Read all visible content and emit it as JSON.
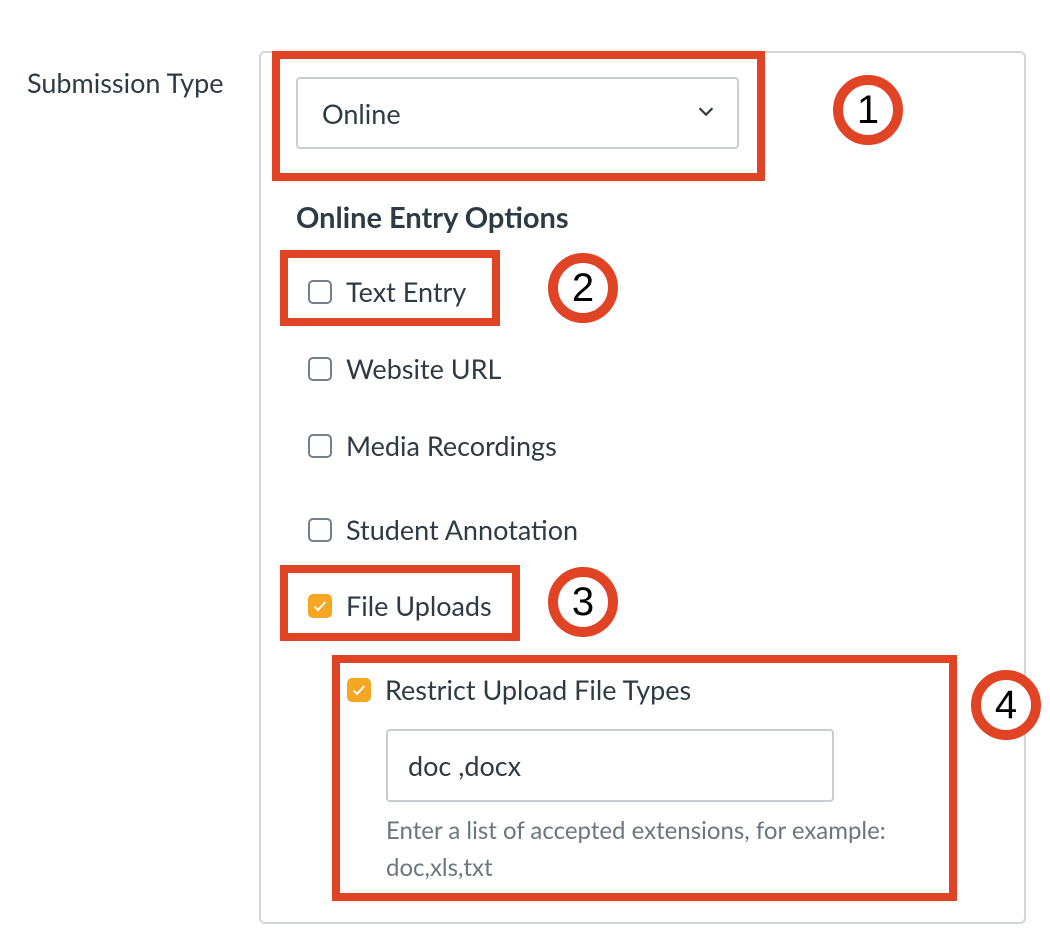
{
  "label": "Submission Type",
  "submission_type": {
    "selected": "Online"
  },
  "section_heading": "Online Entry Options",
  "options": {
    "text_entry": {
      "label": "Text Entry",
      "checked": false
    },
    "website_url": {
      "label": "Website URL",
      "checked": false
    },
    "media_recordings": {
      "label": "Media Recordings",
      "checked": false
    },
    "student_annotation": {
      "label": "Student Annotation",
      "checked": false
    },
    "file_uploads": {
      "label": "File Uploads",
      "checked": true
    },
    "restrict_types": {
      "label": "Restrict Upload File Types",
      "checked": true
    }
  },
  "file_types": {
    "value": "doc ,docx",
    "help": "Enter a list of accepted extensions, for example: doc,xls,txt"
  },
  "annotations": {
    "badge1": "1",
    "badge2": "2",
    "badge3": "3",
    "badge4": "4"
  }
}
